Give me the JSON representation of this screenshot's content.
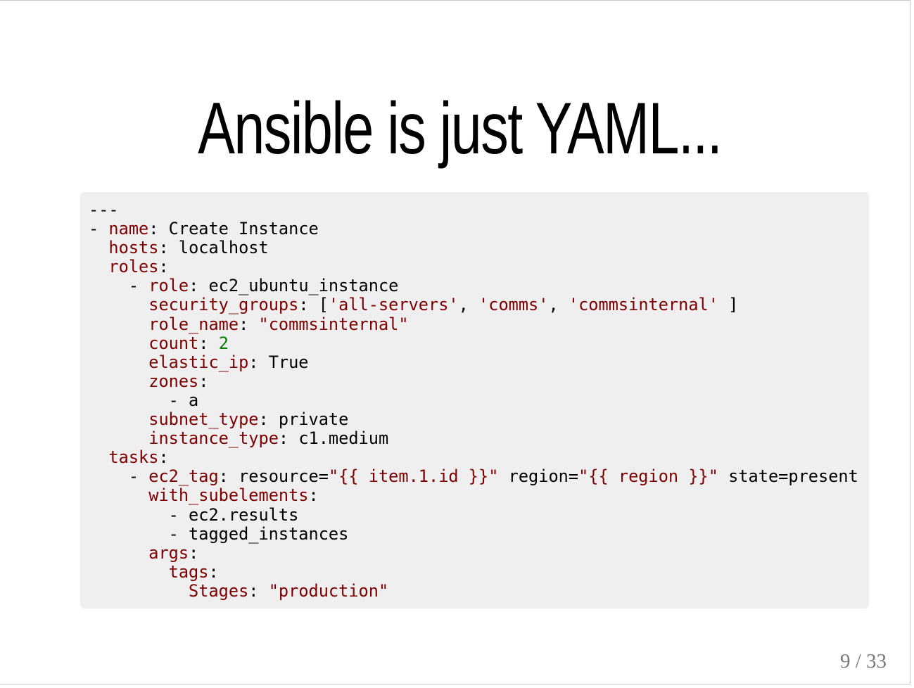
{
  "slide": {
    "title": "Ansible is just YAML...",
    "page_number": "9 / 33"
  },
  "code": {
    "language": "yaml",
    "lines": [
      [
        {
          "t": "---",
          "k": "plain"
        }
      ],
      [
        {
          "t": "- ",
          "k": "plain"
        },
        {
          "t": "name",
          "k": "key"
        },
        {
          "t": ": Create Instance",
          "k": "plain"
        }
      ],
      [
        {
          "t": "  ",
          "k": "plain"
        },
        {
          "t": "hosts",
          "k": "key"
        },
        {
          "t": ": localhost",
          "k": "plain"
        }
      ],
      [
        {
          "t": "  ",
          "k": "plain"
        },
        {
          "t": "roles",
          "k": "key"
        },
        {
          "t": ":",
          "k": "plain"
        }
      ],
      [
        {
          "t": "    - ",
          "k": "plain"
        },
        {
          "t": "role",
          "k": "key"
        },
        {
          "t": ": ec2_ubuntu_instance",
          "k": "plain"
        }
      ],
      [
        {
          "t": "      ",
          "k": "plain"
        },
        {
          "t": "security_groups",
          "k": "key"
        },
        {
          "t": ": [",
          "k": "plain"
        },
        {
          "t": "'all-servers'",
          "k": "str"
        },
        {
          "t": ", ",
          "k": "plain"
        },
        {
          "t": "'comms'",
          "k": "str"
        },
        {
          "t": ", ",
          "k": "plain"
        },
        {
          "t": "'commsinternal'",
          "k": "str"
        },
        {
          "t": " ]",
          "k": "plain"
        }
      ],
      [
        {
          "t": "      ",
          "k": "plain"
        },
        {
          "t": "role_name",
          "k": "key"
        },
        {
          "t": ": ",
          "k": "plain"
        },
        {
          "t": "\"commsinternal\"",
          "k": "str"
        }
      ],
      [
        {
          "t": "      ",
          "k": "plain"
        },
        {
          "t": "count",
          "k": "key"
        },
        {
          "t": ": ",
          "k": "plain"
        },
        {
          "t": "2",
          "k": "num"
        }
      ],
      [
        {
          "t": "      ",
          "k": "plain"
        },
        {
          "t": "elastic_ip",
          "k": "key"
        },
        {
          "t": ": True",
          "k": "plain"
        }
      ],
      [
        {
          "t": "      ",
          "k": "plain"
        },
        {
          "t": "zones",
          "k": "key"
        },
        {
          "t": ":",
          "k": "plain"
        }
      ],
      [
        {
          "t": "        - a",
          "k": "plain"
        }
      ],
      [
        {
          "t": "      ",
          "k": "plain"
        },
        {
          "t": "subnet_type",
          "k": "key"
        },
        {
          "t": ": private",
          "k": "plain"
        }
      ],
      [
        {
          "t": "      ",
          "k": "plain"
        },
        {
          "t": "instance_type",
          "k": "key"
        },
        {
          "t": ": c1.medium",
          "k": "plain"
        }
      ],
      [
        {
          "t": "  ",
          "k": "plain"
        },
        {
          "t": "tasks",
          "k": "key"
        },
        {
          "t": ":",
          "k": "plain"
        }
      ],
      [
        {
          "t": "    - ",
          "k": "plain"
        },
        {
          "t": "ec2_tag",
          "k": "key"
        },
        {
          "t": ": resource=",
          "k": "plain"
        },
        {
          "t": "\"{{ item.1.id }}\"",
          "k": "str"
        },
        {
          "t": " region=",
          "k": "plain"
        },
        {
          "t": "\"{{ region }}\"",
          "k": "str"
        },
        {
          "t": " state=present",
          "k": "plain"
        }
      ],
      [
        {
          "t": "      ",
          "k": "plain"
        },
        {
          "t": "with_subelements",
          "k": "key"
        },
        {
          "t": ":",
          "k": "plain"
        }
      ],
      [
        {
          "t": "        - ec2.results",
          "k": "plain"
        }
      ],
      [
        {
          "t": "        - tagged_instances",
          "k": "plain"
        }
      ],
      [
        {
          "t": "      ",
          "k": "plain"
        },
        {
          "t": "args",
          "k": "key"
        },
        {
          "t": ":",
          "k": "plain"
        }
      ],
      [
        {
          "t": "        ",
          "k": "plain"
        },
        {
          "t": "tags",
          "k": "key"
        },
        {
          "t": ":",
          "k": "plain"
        }
      ],
      [
        {
          "t": "          ",
          "k": "plain"
        },
        {
          "t": "Stages",
          "k": "key"
        },
        {
          "t": ": ",
          "k": "plain"
        },
        {
          "t": "\"production\"",
          "k": "str"
        }
      ]
    ]
  },
  "colors": {
    "key": "#7f0000",
    "string": "#7f0000",
    "number": "#008000",
    "code_background": "#efefef",
    "page_number": "#777777"
  }
}
